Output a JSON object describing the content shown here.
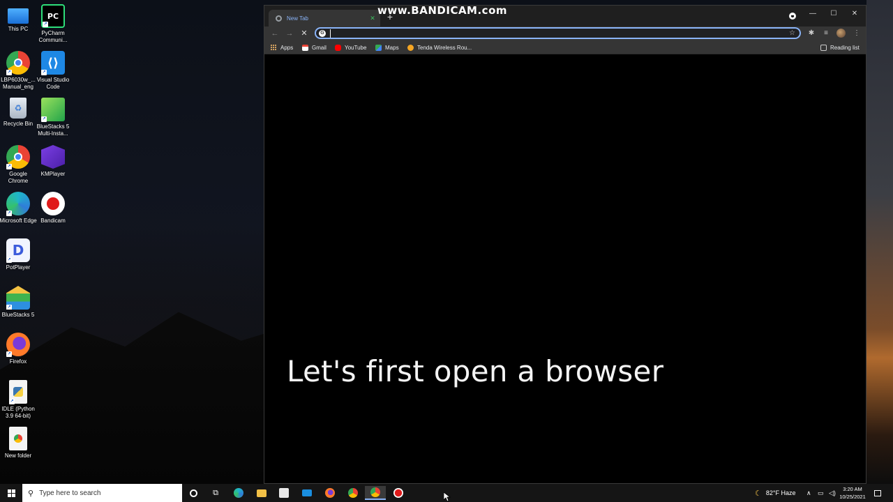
{
  "desktop": {
    "icons": [
      {
        "label": "This PC",
        "icon": "computer-icon"
      },
      {
        "label": "PyCharm Communi...",
        "icon": "pycharm-icon"
      },
      {
        "label": "LBP6030w_... Manual_eng",
        "icon": "chrome-shortcut-icon"
      },
      {
        "label": "Visual Studio Code",
        "icon": "vscode-icon"
      },
      {
        "label": "Recycle Bin",
        "icon": "recycle-bin-icon"
      },
      {
        "label": "BlueStacks 5 Multi-Insta...",
        "icon": "bluestacks-multi-icon"
      },
      {
        "label": "Google Chrome",
        "icon": "chrome-icon"
      },
      {
        "label": "KMPlayer",
        "icon": "kmplayer-icon"
      },
      {
        "label": "Microsoft Edge",
        "icon": "edge-icon"
      },
      {
        "label": "Bandicam",
        "icon": "bandicam-icon"
      },
      {
        "label": "PotPlayer",
        "icon": "potplayer-icon"
      },
      {
        "label": "BlueStacks 5",
        "icon": "bluestacks-icon"
      },
      {
        "label": "Firefox",
        "icon": "firefox-icon"
      },
      {
        "label": "IDLE (Python 3.9 64-bit)",
        "icon": "idle-python-icon"
      },
      {
        "label": "New folder",
        "icon": "folder-icon"
      }
    ]
  },
  "browser": {
    "tab_title": "New Tab",
    "tab_close": "✕",
    "new_tab": "+",
    "watermark": "www.BANDICAM.com",
    "window_controls": {
      "minimize": "—",
      "maximize": "☐",
      "close": "✕"
    },
    "nav": {
      "back": "←",
      "forward": "→",
      "stop": "✕"
    },
    "omnibox": {
      "value": "",
      "placeholder": ""
    },
    "bookmarks": [
      {
        "label": "Apps",
        "icon": "apps-grid-icon"
      },
      {
        "label": "Gmail",
        "icon": "gmail-icon"
      },
      {
        "label": "YouTube",
        "icon": "youtube-icon"
      },
      {
        "label": "Maps",
        "icon": "maps-icon"
      },
      {
        "label": "Tenda Wireless Rou...",
        "icon": "tenda-icon"
      }
    ],
    "reading_list": "Reading list",
    "caption": "Let's first open a browser"
  },
  "taskbar": {
    "search_placeholder": "Type here to search",
    "weather": "82°F  Haze",
    "time": "3:20 AM",
    "date": "10/25/2021"
  },
  "colors": {
    "accent": "#8ab4f8",
    "browser_bg": "#000000",
    "toolbar_bg": "#353535",
    "taskbar_bg": "#151515"
  }
}
